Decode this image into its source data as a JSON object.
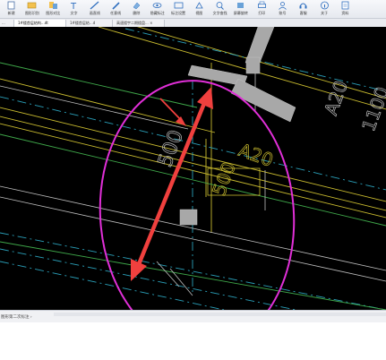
{
  "toolbar": {
    "items": [
      {
        "label": "新建",
        "icon": "new-file-icon"
      },
      {
        "label": "图形识别",
        "icon": "recognize-icon"
      },
      {
        "label": "图形对比",
        "icon": "compare-icon"
      },
      {
        "label": "文字",
        "icon": "text-icon"
      },
      {
        "label": "画直线",
        "icon": "line-icon"
      },
      {
        "label": "任意线",
        "icon": "pencil-icon"
      },
      {
        "label": "删除",
        "icon": "eraser-icon"
      },
      {
        "label": "隐藏标注",
        "icon": "eye-icon"
      },
      {
        "label": "标注设置",
        "icon": "settings-icon"
      },
      {
        "label": "视图",
        "icon": "view-icon"
      },
      {
        "label": "文字查找",
        "icon": "text-search-icon"
      },
      {
        "label": "屏幕旋转",
        "icon": "rotate-icon"
      },
      {
        "label": "打印",
        "icon": "print-icon"
      },
      {
        "label": "账号",
        "icon": "account-icon"
      },
      {
        "label": "客服",
        "icon": "headset-icon"
      },
      {
        "label": "关于",
        "icon": "info-icon"
      },
      {
        "label": "资料",
        "icon": "document-icon"
      }
    ]
  },
  "tabs": [
    {
      "label": "..."
    },
    {
      "label": "1#楼首层结构...dt"
    },
    {
      "label": "1#楼首层结...d"
    },
    {
      "label": "高速楼宇二期楼盘... ×"
    }
  ],
  "drawing": {
    "dimension_labels": [
      "A20",
      "500",
      "A20",
      "1100",
      "500"
    ]
  },
  "status": {
    "text": "图形第二次标注 ›"
  },
  "colors": {
    "canvas": "#000000",
    "annotation_ellipse": "#e12fd8",
    "annotation_arrow": "#f0403e",
    "beam_gray": "#a8a8a8",
    "cad_yellow": "#c9bb2f",
    "cad_cyan": "#2a9fb8",
    "cad_green": "#3fa84a",
    "cad_white": "#c8c8c8"
  }
}
